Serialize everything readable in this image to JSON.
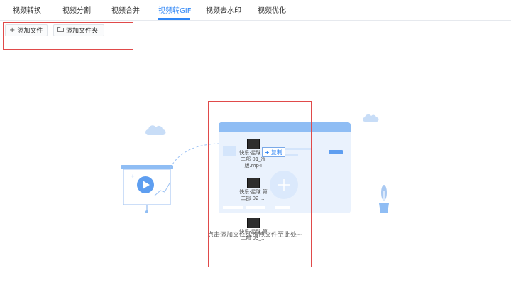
{
  "tabs": [
    {
      "label": "视频转换",
      "active": false
    },
    {
      "label": "视频分割",
      "active": false
    },
    {
      "label": "视频合并",
      "active": false
    },
    {
      "label": "视频转GIF",
      "active": true
    },
    {
      "label": "视频去水印",
      "active": false
    },
    {
      "label": "视频优化",
      "active": false
    }
  ],
  "toolbar": {
    "add_file_label": "添加文件",
    "add_folder_label": "添加文件夹",
    "add_file_icon": "plus-icon",
    "add_folder_icon": "folder-icon"
  },
  "drop_area": {
    "hint": "点击添加文件或拖拽文件至此处~",
    "copy_label": "复制",
    "files": [
      {
        "name_line1": "快乐·星球 第",
        "name_line2": "二部 01_简",
        "name_line3": "版.mp4"
      },
      {
        "name_line1": "快乐·星球 第",
        "name_line2": "二部 02_..."
      },
      {
        "name_line1": "快乐·星球 第",
        "name_line2": "二部 03_..."
      }
    ]
  },
  "colors": {
    "accent": "#2f86f6",
    "highlight_box": "#e04a4a",
    "illustration_light": "#eaf2fd",
    "illustration_mid": "#8fbdf4"
  }
}
